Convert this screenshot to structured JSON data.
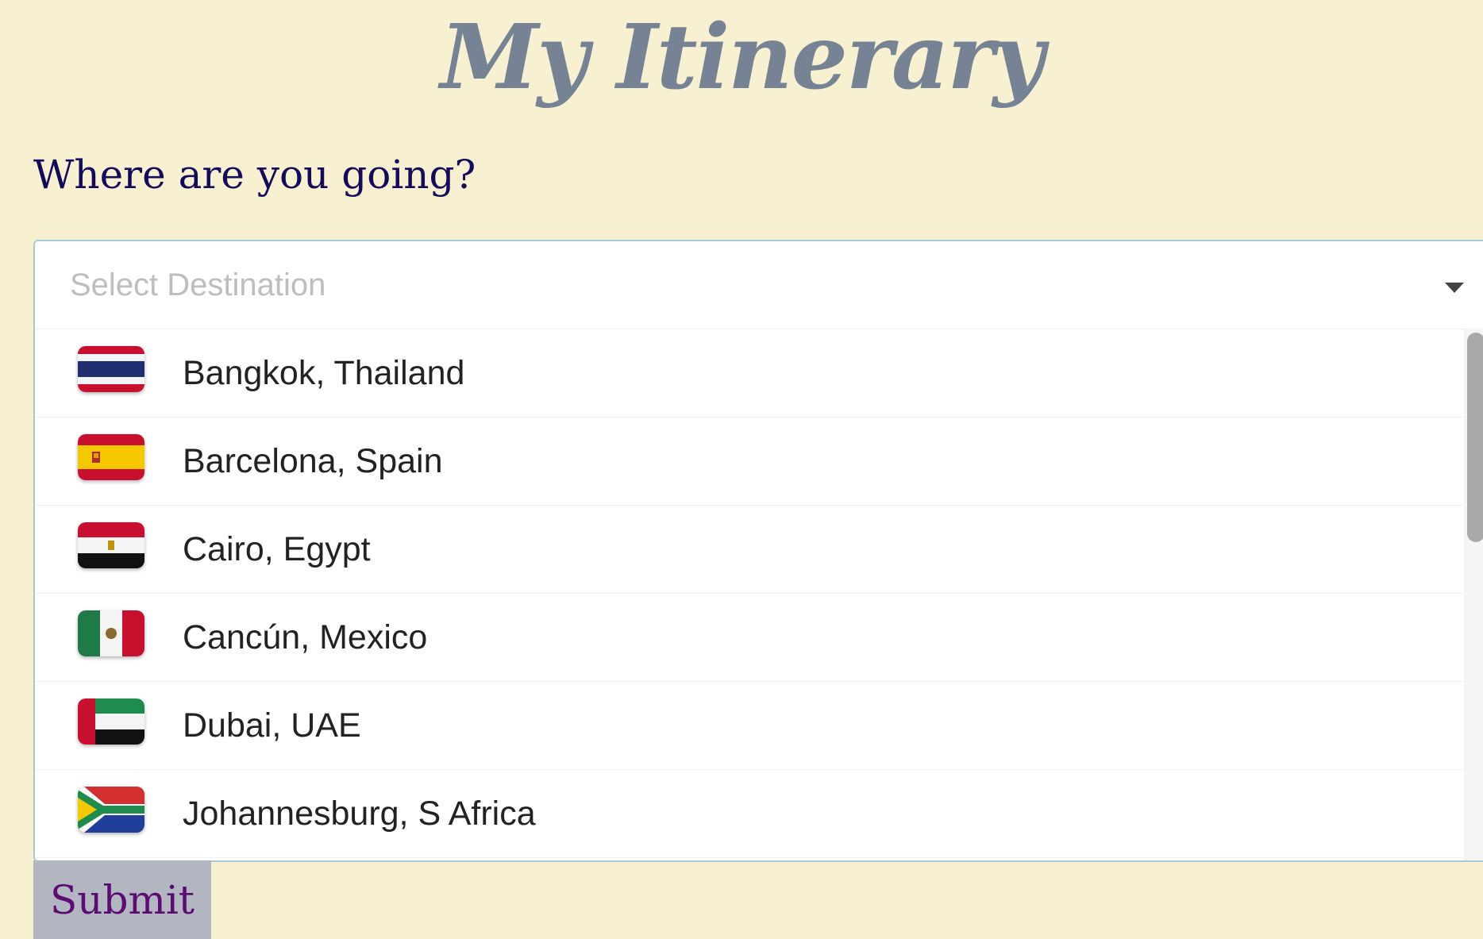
{
  "page": {
    "title": "My Itinerary",
    "question": "Where are you going?"
  },
  "select": {
    "placeholder": "Select Destination",
    "options": [
      {
        "label": "Bangkok, Thailand",
        "flag_icon": "thailand-flag-icon"
      },
      {
        "label": "Barcelona, Spain",
        "flag_icon": "spain-flag-icon"
      },
      {
        "label": "Cairo, Egypt",
        "flag_icon": "egypt-flag-icon"
      },
      {
        "label": "Cancún, Mexico",
        "flag_icon": "mexico-flag-icon"
      },
      {
        "label": "Dubai, UAE",
        "flag_icon": "uae-flag-icon"
      },
      {
        "label": "Johannesburg, S Africa",
        "flag_icon": "south-africa-flag-icon"
      }
    ]
  },
  "form": {
    "submit_label": "Submit"
  },
  "colors": {
    "background": "#f8f1d1",
    "title": "#768394",
    "question": "#120b5c",
    "submit_text": "#5d0a73",
    "submit_bg": "#b2b6c0"
  }
}
